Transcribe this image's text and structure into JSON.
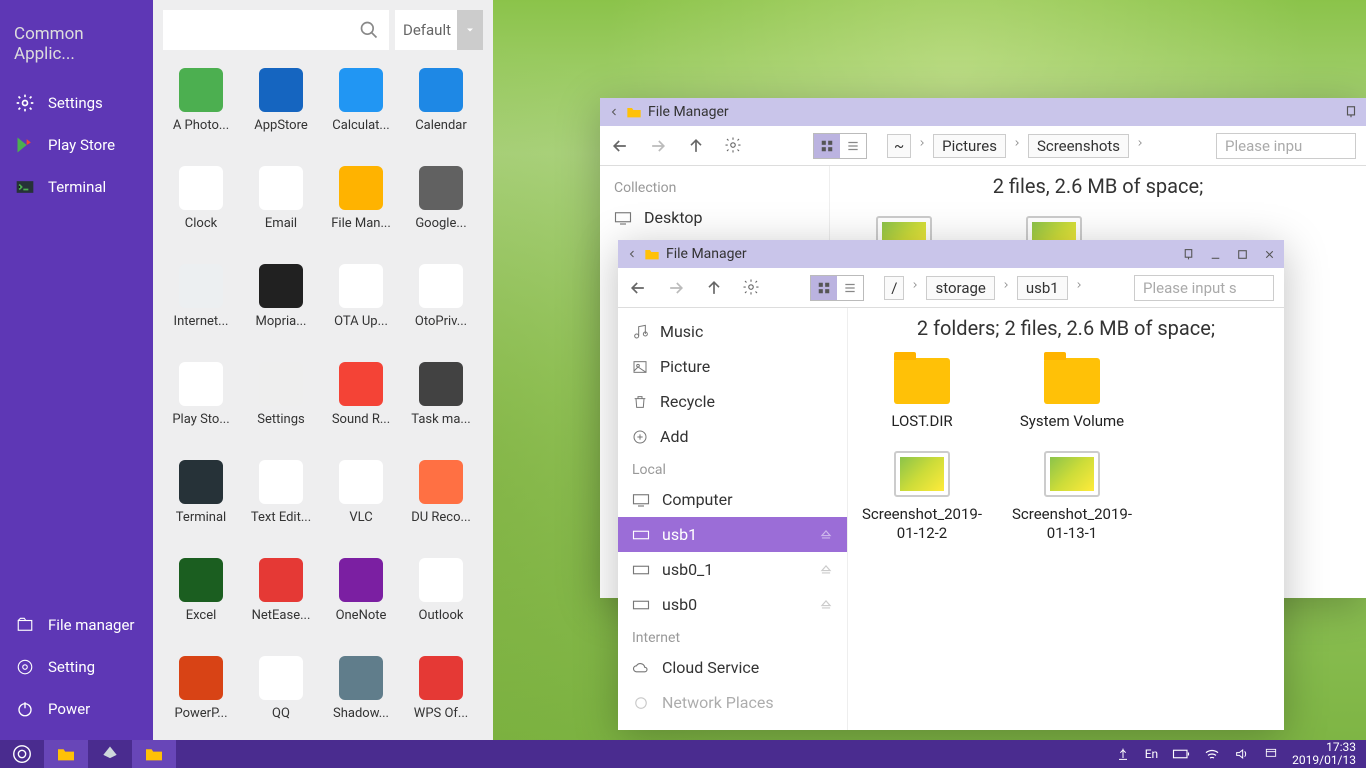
{
  "startmenu": {
    "title": "Common Applic...",
    "pinned": [
      {
        "label": "Settings"
      },
      {
        "label": "Play Store"
      },
      {
        "label": "Terminal"
      }
    ],
    "bottom": [
      {
        "label": "File manager"
      },
      {
        "label": "Setting"
      },
      {
        "label": "Power"
      }
    ]
  },
  "apppanel": {
    "sort_label": "Default",
    "apps": [
      {
        "label": "A Photo...",
        "bg": "#4caf50"
      },
      {
        "label": "AppStore",
        "bg": "#1565c0"
      },
      {
        "label": "Calculat...",
        "bg": "#2196f3"
      },
      {
        "label": "Calendar",
        "bg": "#1e88e5"
      },
      {
        "label": "Clock",
        "bg": "#ffffff"
      },
      {
        "label": "Email",
        "bg": "#ffffff"
      },
      {
        "label": "File Man...",
        "bg": "#ffb300"
      },
      {
        "label": "Google...",
        "bg": "#616161"
      },
      {
        "label": "Internet...",
        "bg": "#eceff1"
      },
      {
        "label": "Mopria...",
        "bg": "#212121"
      },
      {
        "label": "OTA Up...",
        "bg": "#ffffff"
      },
      {
        "label": "OtoPriv...",
        "bg": "#ffffff"
      },
      {
        "label": "Play Sto...",
        "bg": "#ffffff"
      },
      {
        "label": "Settings",
        "bg": "#eeeeee"
      },
      {
        "label": "Sound R...",
        "bg": "#f44336"
      },
      {
        "label": "Task ma...",
        "bg": "#424242"
      },
      {
        "label": "Terminal",
        "bg": "#263238"
      },
      {
        "label": "Text Edit...",
        "bg": "#ffffff"
      },
      {
        "label": "VLC",
        "bg": "#ffffff"
      },
      {
        "label": "DU Reco...",
        "bg": "#ff7043"
      },
      {
        "label": "Excel",
        "bg": "#1b5e20"
      },
      {
        "label": "NetEase...",
        "bg": "#e53935"
      },
      {
        "label": "OneNote",
        "bg": "#7b1fa2"
      },
      {
        "label": "Outlook",
        "bg": "#ffffff"
      },
      {
        "label": "PowerP...",
        "bg": "#d84315"
      },
      {
        "label": "QQ",
        "bg": "#ffffff"
      },
      {
        "label": "Shadow...",
        "bg": "#607d8b"
      },
      {
        "label": "WPS Of...",
        "bg": "#e53935"
      }
    ]
  },
  "fm1": {
    "title": "File Manager",
    "status": "2 files, 2.6 MB of space;",
    "crumbs": [
      "~",
      "Pictures",
      "Screenshots"
    ],
    "search_placeholder": "Please inpu",
    "side": {
      "sec1": "Collection",
      "rows1": [
        {
          "label": "Desktop"
        }
      ]
    }
  },
  "fm2": {
    "title": "File Manager",
    "status": "2 folders;    2 files, 2.6 MB of space;",
    "crumbs": [
      "/",
      "storage",
      "usb1"
    ],
    "search_placeholder": "Please input s",
    "side": {
      "rows_top": [
        {
          "label": "Music"
        },
        {
          "label": "Picture"
        },
        {
          "label": "Recycle"
        },
        {
          "label": "Add"
        }
      ],
      "sec_local": "Local",
      "rows_local": [
        {
          "label": "Computer"
        },
        {
          "label": "usb1"
        },
        {
          "label": "usb0_1"
        },
        {
          "label": "usb0"
        }
      ],
      "sec_net": "Internet",
      "rows_net": [
        {
          "label": "Cloud Service"
        },
        {
          "label": "Network Places"
        }
      ]
    },
    "files": [
      {
        "label": "LOST.DIR",
        "type": "folder"
      },
      {
        "label": "System Volume",
        "type": "folder"
      },
      {
        "label": "Screenshot_2019-01-12-2",
        "type": "image"
      },
      {
        "label": "Screenshot_2019-01-13-1",
        "type": "image"
      }
    ]
  },
  "taskbar": {
    "time": "17:33",
    "date": "2019/01/13",
    "lang": "En"
  }
}
